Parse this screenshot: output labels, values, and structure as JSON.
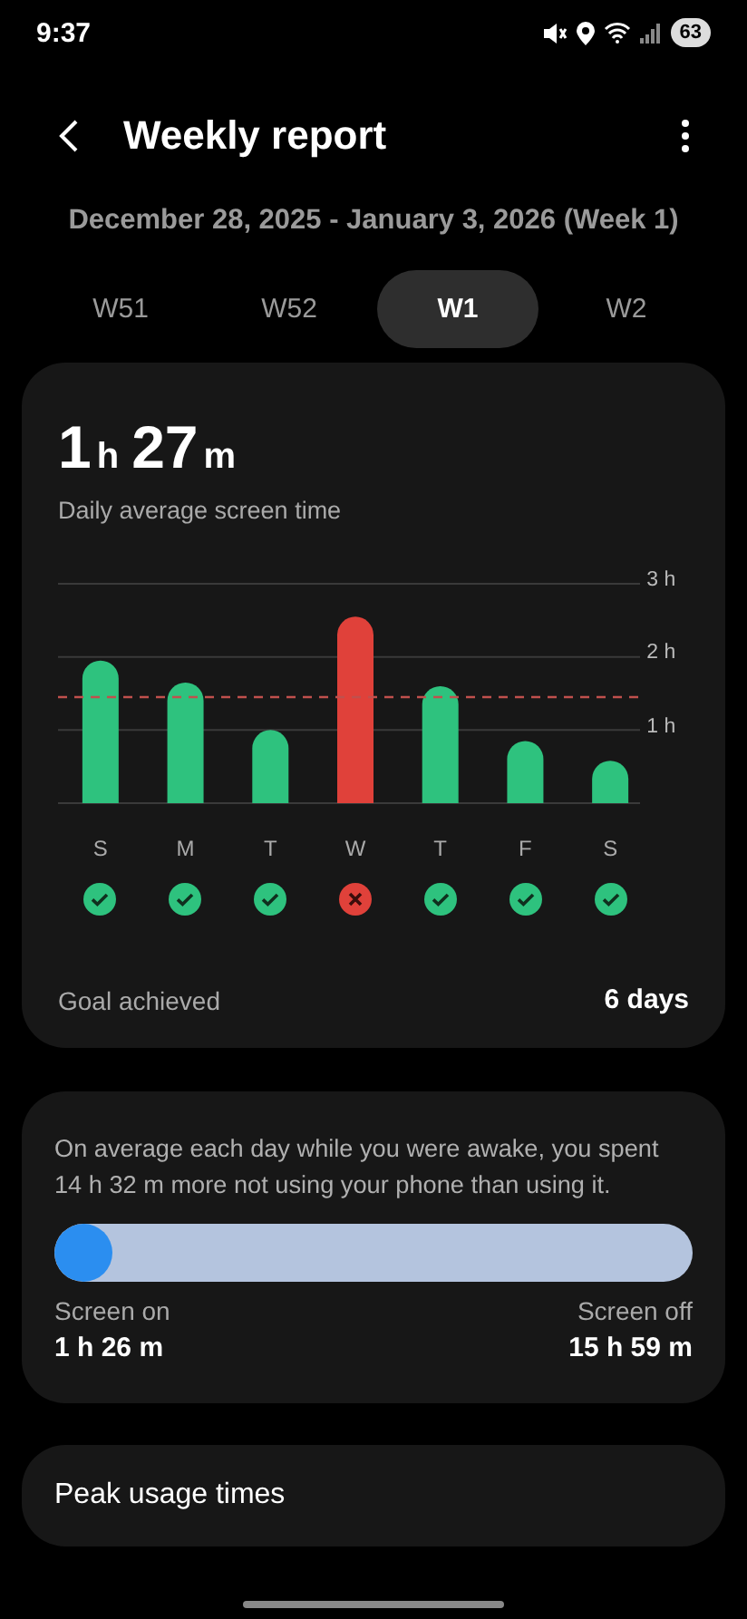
{
  "status_bar": {
    "time": "9:37",
    "battery": "63"
  },
  "header": {
    "title": "Weekly report"
  },
  "date_range": "December 28, 2025 - January 3, 2026 (Week 1)",
  "tabs": [
    {
      "label": "W51",
      "selected": false
    },
    {
      "label": "W52",
      "selected": false
    },
    {
      "label": "W1",
      "selected": true
    },
    {
      "label": "W2",
      "selected": false
    }
  ],
  "summary": {
    "value_hours": "1",
    "unit_h": "h",
    "value_minutes": "27",
    "unit_m": "m",
    "caption": "Daily average screen time",
    "chart_data": {
      "type": "bar",
      "categories": [
        "S",
        "M",
        "T",
        "W",
        "T",
        "F",
        "S"
      ],
      "series": [
        {
          "color": "#2ec27e",
          "values": [
            1.95,
            1.65,
            1.0,
            null,
            1.6,
            0.85,
            0.58
          ]
        },
        {
          "color": "#e0413a",
          "values": [
            null,
            null,
            null,
            2.55,
            null,
            null,
            null
          ]
        }
      ],
      "stacked": true,
      "ylim": [
        0,
        3
      ],
      "yticks": [
        {
          "value": 1,
          "label": "1 h"
        },
        {
          "value": 2,
          "label": "2 h"
        },
        {
          "value": 3,
          "label": "3 h"
        }
      ],
      "ref_lines": [
        {
          "axis": "y",
          "value": 1.45,
          "color": "#c0504d"
        }
      ]
    },
    "goal_status": [
      {
        "achieved": true
      },
      {
        "achieved": true
      },
      {
        "achieved": true
      },
      {
        "achieved": false
      },
      {
        "achieved": true
      },
      {
        "achieved": true
      },
      {
        "achieved": true
      }
    ],
    "goal_label": "Goal achieved",
    "goal_value": "6 days"
  },
  "usage": {
    "text": "On average each day while you were awake, you spent 14 h 32 m more not using your phone than using it.",
    "level": 0.082,
    "on_label": "Screen on",
    "on_value": "1 h 26 m",
    "off_label": "Screen off",
    "off_value": "15 h 59 m"
  },
  "peak": {
    "title": "Peak usage times"
  }
}
